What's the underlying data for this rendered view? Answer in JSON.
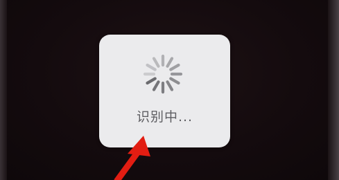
{
  "hud": {
    "label": "识别中...",
    "spinner_icon": "activity-spinner-icon"
  },
  "annotation": {
    "arrow_icon": "red-arrow-icon",
    "arrow_color": "#e21d12"
  },
  "colors": {
    "background": "#120a0c",
    "hud_background": "#ebebed",
    "hud_text": "#5e5e62",
    "spinner": "#6b6b6f"
  }
}
